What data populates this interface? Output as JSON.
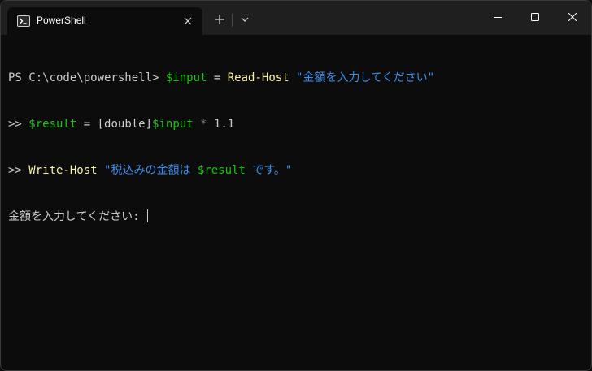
{
  "window": {
    "tab_title": "PowerShell"
  },
  "icons": {
    "tab": "powershell-icon",
    "close": "close-icon",
    "new_tab": "plus-icon",
    "dropdown": "chevron-down-icon",
    "minimize": "minimize-icon",
    "maximize": "maximize-icon",
    "window_close": "close-icon"
  },
  "colors": {
    "background": "#0c0c0c",
    "titlebar": "#1f1f1f",
    "text": "#cccccc",
    "variable": "#16c60c",
    "command": "#f9f1a5",
    "string": "#3b8eea",
    "operator": "#767676"
  },
  "terminal": {
    "line1": {
      "prompt": "PS C:\\code\\powershell> ",
      "var": "$input",
      "op": " = ",
      "cmd": "Read-Host",
      "space": " ",
      "str": "\"金額を入力してください\""
    },
    "line2": {
      "prompt": ">> ",
      "var1": "$result",
      "op1": " = ",
      "type": "[double]",
      "var2": "$input",
      "op2": " * ",
      "num": "1.1"
    },
    "line3": {
      "prompt": ">> ",
      "cmd": "Write-Host",
      "space": " ",
      "str1": "\"税込みの金額は ",
      "var": "$result",
      "str2": " です。\""
    },
    "line4": {
      "text": "金額を入力してください: "
    }
  }
}
